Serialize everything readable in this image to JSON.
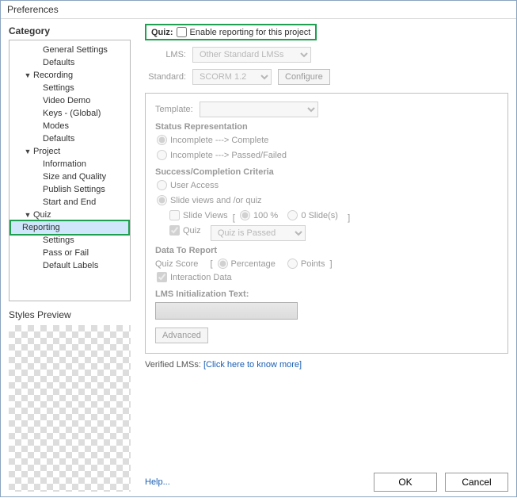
{
  "window": {
    "title": "Preferences"
  },
  "sidebar": {
    "heading": "Category",
    "styles_preview": "Styles Preview",
    "items": [
      {
        "label": "General Settings",
        "level": 2,
        "exp": ""
      },
      {
        "label": "Defaults",
        "level": 2,
        "exp": ""
      },
      {
        "label": "Recording",
        "level": 1,
        "exp": "▼"
      },
      {
        "label": "Settings",
        "level": 2,
        "exp": ""
      },
      {
        "label": "Video Demo",
        "level": 2,
        "exp": ""
      },
      {
        "label": "Keys - (Global)",
        "level": 2,
        "exp": ""
      },
      {
        "label": "Modes",
        "level": 2,
        "exp": ""
      },
      {
        "label": "Defaults",
        "level": 2,
        "exp": ""
      },
      {
        "label": "Project",
        "level": 1,
        "exp": "▼"
      },
      {
        "label": "Information",
        "level": 2,
        "exp": ""
      },
      {
        "label": "Size and Quality",
        "level": 2,
        "exp": ""
      },
      {
        "label": "Publish Settings",
        "level": 2,
        "exp": ""
      },
      {
        "label": "Start and End",
        "level": 2,
        "exp": ""
      },
      {
        "label": "Quiz",
        "level": 1,
        "exp": "▼"
      },
      {
        "label": "Reporting",
        "level": 2,
        "exp": "",
        "selected": true
      },
      {
        "label": "Settings",
        "level": 2,
        "exp": ""
      },
      {
        "label": "Pass or Fail",
        "level": 2,
        "exp": ""
      },
      {
        "label": "Default Labels",
        "level": 2,
        "exp": ""
      }
    ]
  },
  "main": {
    "quiz_label": "Quiz:",
    "enable_reporting": "Enable reporting for this project",
    "lms_label": "LMS:",
    "lms_value": "Other Standard LMSs",
    "standard_label": "Standard:",
    "standard_value": "SCORM 1.2",
    "configure": "Configure",
    "template_label": "Template:",
    "template_value": "",
    "status_rep": "Status Representation",
    "status_opt1": "Incomplete ---> Complete",
    "status_opt2": "Incomplete ---> Passed/Failed",
    "success_title": "Success/Completion Criteria",
    "user_access": "User Access",
    "slide_views_quiz": "Slide views and /or quiz",
    "slide_views": "Slide Views",
    "slide_pct": "100 %",
    "slide_cnt": "0 Slide(s)",
    "quiz_chk": "Quiz",
    "quiz_passed": "Quiz is Passed",
    "data_to_report": "Data To Report",
    "quiz_score": "Quiz Score",
    "percentage": "Percentage",
    "points": "Points",
    "interaction_data": "Interaction Data",
    "lms_init": "LMS Initialization Text:",
    "advanced": "Advanced",
    "verified": "Verified LMSs:",
    "verified_link": "[Click here to know more]"
  },
  "footer": {
    "help": "Help...",
    "ok": "OK",
    "cancel": "Cancel"
  }
}
